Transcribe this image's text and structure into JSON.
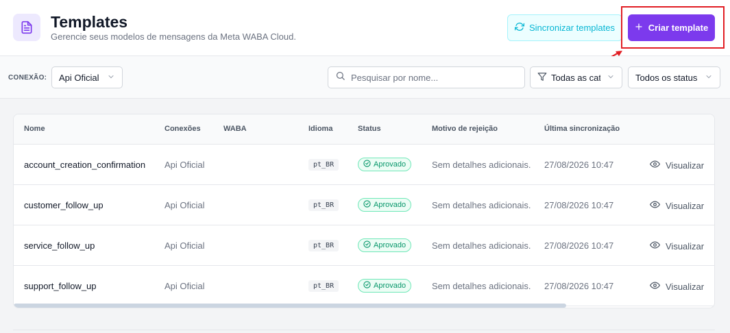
{
  "header": {
    "title": "Templates",
    "subtitle": "Gerencie seus modelos de mensagens da Meta WABA Cloud.",
    "sync_label": "Sincronizar templates",
    "create_label": "Criar template"
  },
  "filters": {
    "connection_label": "CONEXÃO:",
    "connection_value": "Api Oficial",
    "search_placeholder": "Pesquisar por nome...",
    "category_value": "Todas as categorias",
    "status_value": "Todos os status"
  },
  "table": {
    "columns": [
      "Nome",
      "Conexões",
      "WABA",
      "Idioma",
      "Status",
      "Motivo de rejeição",
      "Última sincronização"
    ],
    "rows": [
      {
        "name": "account_creation_confirmation",
        "connection": "Api Oficial",
        "language": "pt_BR",
        "status": "Aprovado",
        "reason": "Sem detalhes adicionais.",
        "synced": "27/08/2026 10:47",
        "action": "Visualizar"
      },
      {
        "name": "customer_follow_up",
        "connection": "Api Oficial",
        "language": "pt_BR",
        "status": "Aprovado",
        "reason": "Sem detalhes adicionais.",
        "synced": "27/08/2026 10:47",
        "action": "Visualizar"
      },
      {
        "name": "service_follow_up",
        "connection": "Api Oficial",
        "language": "pt_BR",
        "status": "Aprovado",
        "reason": "Sem detalhes adicionais.",
        "synced": "27/08/2026 10:47",
        "action": "Visualizar"
      },
      {
        "name": "support_follow_up",
        "connection": "Api Oficial",
        "language": "pt_BR",
        "status": "Aprovado",
        "reason": "Sem detalhes adicionais.",
        "synced": "27/08/2026 10:47",
        "action": "Visualizar"
      }
    ]
  },
  "icons": {
    "page": "document-icon",
    "sync": "refresh-icon",
    "create": "plus-icon",
    "search": "search-icon",
    "filter": "filter-icon",
    "chevron": "chevron-down-icon",
    "status": "check-circle-icon",
    "view": "eye-icon"
  },
  "colors": {
    "accent": "#7c3aed",
    "sync": "#06b6d4",
    "approved": "#059669",
    "highlight": "#e11d23"
  }
}
